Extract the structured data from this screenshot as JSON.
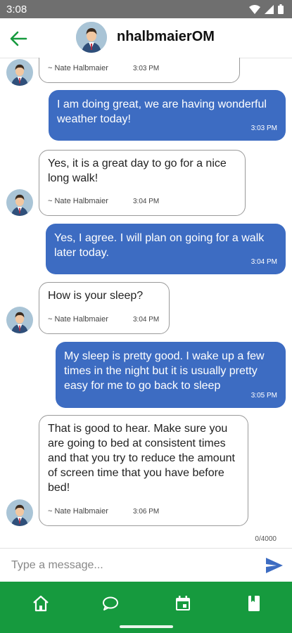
{
  "status_bar": {
    "time": "3:08"
  },
  "header": {
    "title": "nhalbmaierOM"
  },
  "messages": [
    {
      "direction": "in",
      "text": "",
      "sender": "~ Nate Halbmaier",
      "time": "3:03 PM"
    },
    {
      "direction": "out",
      "text": "I am doing great, we are having wonderful weather today!",
      "time": "3:03 PM"
    },
    {
      "direction": "in",
      "text": "Yes, it is a great day to go for a nice long walk!",
      "sender": "~ Nate Halbmaier",
      "time": "3:04 PM"
    },
    {
      "direction": "out",
      "text": "Yes, I agree.  I will plan on going for a walk later today.",
      "time": "3:04 PM"
    },
    {
      "direction": "in",
      "text": "How is your sleep?",
      "sender": "~ Nate Halbmaier",
      "time": "3:04 PM"
    },
    {
      "direction": "out",
      "text": "My sleep is pretty good.  I wake up a few times in the night but it is usually pretty easy for me to go back to sleep",
      "time": "3:05 PM"
    },
    {
      "direction": "in",
      "text": "That is good to hear.  Make sure you are going to bed at consistent times and that you try to reduce the amount of screen time that you have before bed!",
      "sender": "~ Nate Halbmaier",
      "time": "3:06 PM"
    }
  ],
  "composer": {
    "char_count": "0/4000",
    "placeholder": "Type a message..."
  },
  "bottom_nav": {
    "items": [
      "home-icon",
      "chat-bubble-icon",
      "calendar-icon",
      "book-icon"
    ]
  },
  "colors": {
    "accent": "#169a3e",
    "outgoing_bubble": "#3d6cc2",
    "status_bar": "#6f6f6f"
  }
}
